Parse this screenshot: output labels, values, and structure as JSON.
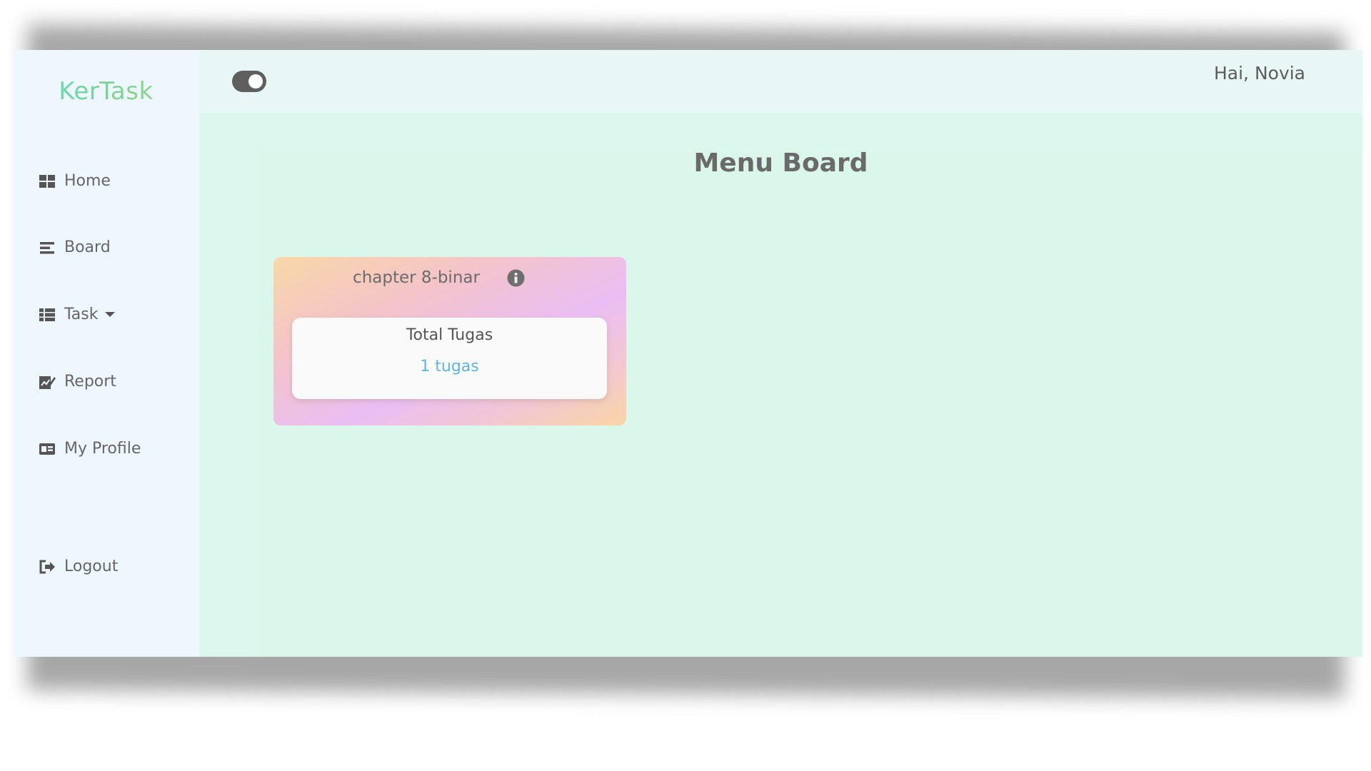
{
  "brand": {
    "name": "KerTask"
  },
  "sidebar": {
    "items": [
      {
        "label": "Home",
        "icon": "grid-icon"
      },
      {
        "label": "Board",
        "icon": "bars-icon"
      },
      {
        "label": "Task",
        "icon": "list-icon"
      },
      {
        "label": "Report",
        "icon": "edit-chart-icon"
      },
      {
        "label": "My Profile",
        "icon": "id-card-icon"
      },
      {
        "label": "Logout",
        "icon": "sign-out-icon"
      }
    ]
  },
  "header": {
    "greeting": "Hai, Novia",
    "theme_toggle": {
      "state": "on",
      "icon": "toggle-icon"
    }
  },
  "main": {
    "title": "Menu Board",
    "boards": [
      {
        "name": "chapter 8-binar",
        "info_icon": "info-icon",
        "stat_label": "Total Tugas",
        "stat_value": "1 tugas"
      }
    ]
  },
  "colors": {
    "brand_gradient": [
      "#5fe0b1",
      "#9bd67f"
    ],
    "sidebar_bg": "#eef7fd",
    "main_bg": "#dbf7ec",
    "accent_link": "#5fb4e6"
  }
}
